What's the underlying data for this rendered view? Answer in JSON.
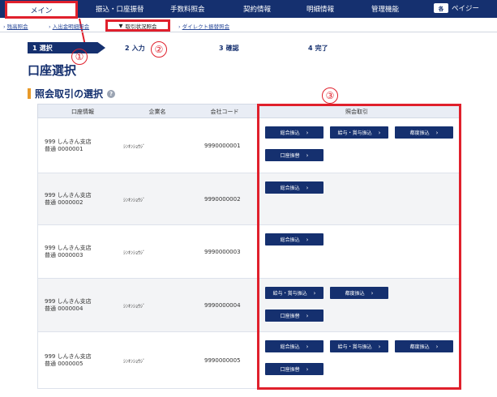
{
  "topnav": {
    "items": [
      "メイン",
      "振込・口座振替",
      "手数料照会",
      "契約情報",
      "明細情報",
      "管理機能"
    ],
    "user_icon": "各",
    "user_name": "ペイジー"
  },
  "subnav": {
    "items": [
      "残高照会",
      "入出金明細照会",
      "取引状況照会",
      "ダイレクト振替照会"
    ],
    "active_marker": "▼"
  },
  "steps": [
    {
      "num": "1",
      "label": "選択"
    },
    {
      "num": "2",
      "label": "入力"
    },
    {
      "num": "3",
      "label": "確認"
    },
    {
      "num": "4",
      "label": "完了"
    }
  ],
  "callouts": [
    "①",
    "②",
    "③"
  ],
  "page_title": "口座選択",
  "section_title": "照会取引の選択",
  "help_icon": "?",
  "table": {
    "headers": [
      "口座情報",
      "企業名",
      "会社コード",
      "照会取引"
    ],
    "rows": [
      {
        "branch": "999 しんきん支店",
        "account": "普通 0000001",
        "kana": "ｼﾝｷﾝｼｮｳｼﾞ",
        "code": "9990000001",
        "buttons": [
          "総合振込",
          "給与・賞与振込",
          "都度振込",
          "口座振替"
        ]
      },
      {
        "branch": "999 しんきん支店",
        "account": "普通 0000002",
        "kana": "ｼﾝｷﾝｼｮｳｼﾞ",
        "code": "9990000002",
        "buttons": [
          "総合振込"
        ]
      },
      {
        "branch": "999 しんきん支店",
        "account": "普通 0000003",
        "kana": "ｼﾝｷﾝｼｮｳｼﾞ",
        "code": "9990000003",
        "buttons": [
          "総合振込"
        ]
      },
      {
        "branch": "999 しんきん支店",
        "account": "普通 0000004",
        "kana": "ｼﾝｷﾝｼｮｳｼﾞ",
        "code": "9990000004",
        "buttons": [
          "給与・賞与振込",
          "都度振込",
          "口座振替"
        ]
      },
      {
        "branch": "999 しんきん支店",
        "account": "普通 0000005",
        "kana": "ｼﾝｷﾝｼｮｳｼﾞ",
        "code": "9990000005",
        "buttons": [
          "総合振込",
          "給与・賞与振込",
          "都度振込",
          "口座振替"
        ]
      }
    ],
    "button_chevron": "›"
  },
  "colors": {
    "nav": "#15306f",
    "annotation": "#e0202c",
    "accent_bar": "#e89a2a"
  }
}
